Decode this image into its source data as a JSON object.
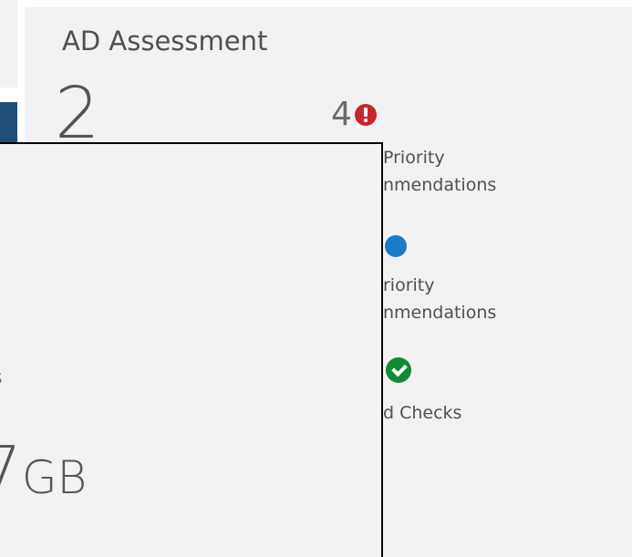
{
  "tile": {
    "title": "AD Assessment",
    "score": "2",
    "high_priority": {
      "count": "4",
      "label_line1": "Priority",
      "label_line2": "nmendations",
      "icon": "error-icon",
      "color": "#c7262c"
    },
    "low_priority": {
      "label_line1": "riority",
      "label_line2": "nmendations",
      "icon": "info-icon",
      "color": "#1c7bc9"
    },
    "passed": {
      "label": "d Checks",
      "icon": "check-icon",
      "color": "#118a33"
    }
  },
  "overlay_panel": {
    "partial_text": "s",
    "size_value": "7",
    "size_unit": "GB"
  },
  "colors": {
    "tile_background": "#f2f2f2",
    "accent_bar": "#1f4e79",
    "overlay_border": "#000000"
  }
}
